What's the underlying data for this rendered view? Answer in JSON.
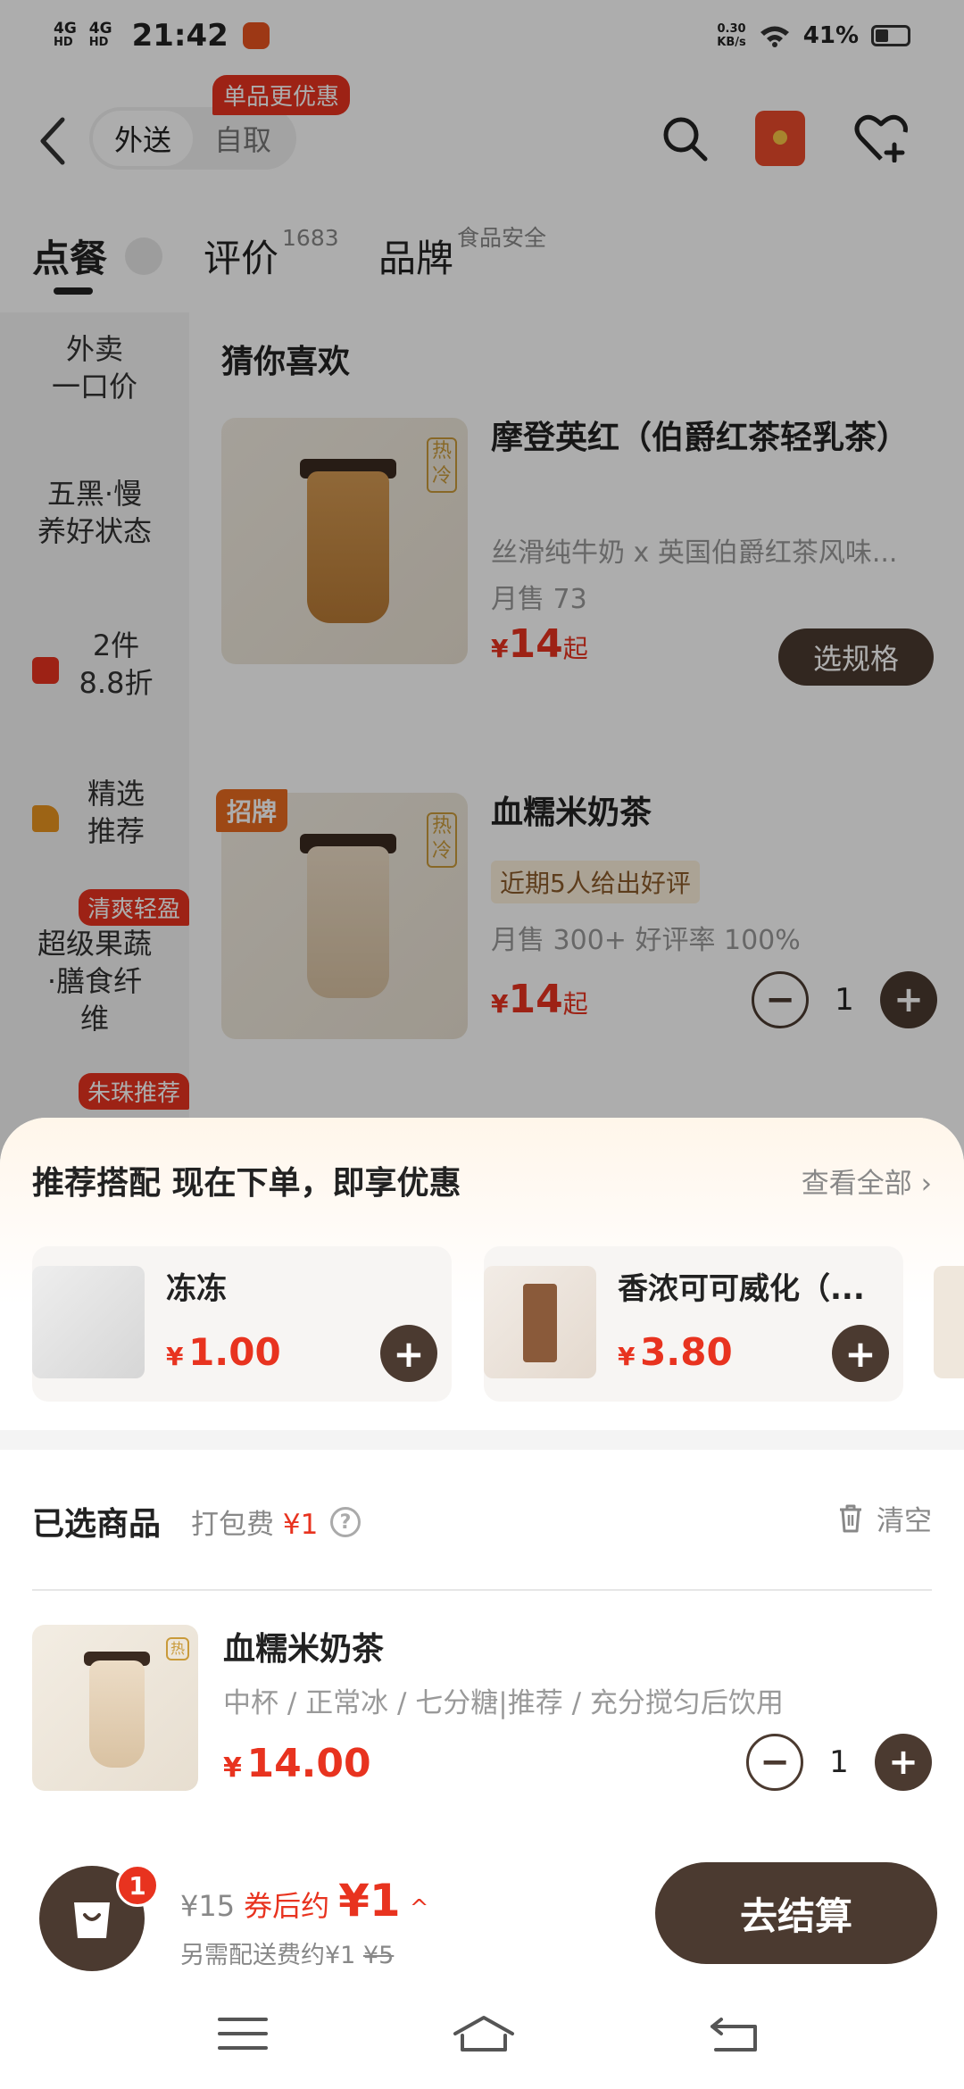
{
  "status_bar": {
    "net1": "4G",
    "net1_sub": "HD",
    "net2": "4G",
    "net2_sub": "HD",
    "time": "21:42",
    "speed_value": "0.30",
    "speed_unit": "KB/s",
    "battery": "41%"
  },
  "nav": {
    "promo_tag": "单品更优惠",
    "mode_delivery": "外送",
    "mode_pickup": "自取"
  },
  "tabs": {
    "order": "点餐",
    "review": "评价",
    "review_count": "1683",
    "brand": "品牌",
    "brand_sub": "食品安全"
  },
  "side_menu": {
    "items": [
      {
        "label": "外卖\n一口价"
      },
      {
        "label": "五黑·慢\n养好状态"
      },
      {
        "label": "2件\n8.8折"
      },
      {
        "label": "精选\n推荐"
      },
      {
        "label": "超级果蔬\n·膳食纤\n维"
      }
    ],
    "badge_fresh": "清爽轻盈",
    "badge_recommend": "朱珠推荐"
  },
  "section": {
    "title": "猜你喜欢"
  },
  "products": [
    {
      "name": "摩登英红（伯爵红茶轻乳茶）",
      "desc": "丝滑纯牛奶 x 英国伯爵红茶风味...",
      "sales": "月售 73",
      "currency": "¥",
      "price": "14",
      "price_suffix": "起",
      "action": "选规格",
      "tag": "热\n冷"
    },
    {
      "name": "血糯米奶茶",
      "badge": "招牌",
      "highlight": "近期5人给出好评",
      "sales": "月售 300+ 好评率 100%",
      "currency": "¥",
      "price": "14",
      "price_suffix": "起",
      "qty": "1",
      "tag": "热\n冷"
    }
  ],
  "recommend": {
    "title": "推荐搭配  现在下单，即享优惠",
    "more": "查看全部 ›",
    "items": [
      {
        "name": "冻冻",
        "currency": "¥",
        "price": "1.00"
      },
      {
        "name": "香浓可可威化（...",
        "currency": "¥",
        "price": "3.80"
      }
    ]
  },
  "selected": {
    "title": "已选商品",
    "fee_label": "打包费",
    "fee": "¥1",
    "help": "?",
    "clear": "清空",
    "item": {
      "name": "血糯米奶茶",
      "spec": "中杯 / 正常冰 / 七分糖|推荐 / 充分搅匀后饮用",
      "currency": "¥",
      "price": "14.00",
      "qty": "1"
    }
  },
  "cart": {
    "count": "1",
    "original": "¥15",
    "after_label": "券后约",
    "after_price": "¥1",
    "chevron": "^",
    "delivery_label": "另需配送费约¥1",
    "delivery_strike": "¥5",
    "checkout": "去结算"
  },
  "colors": {
    "brand_brown": "#4b3a30",
    "price_red": "#e8331f",
    "overlay": "rgba(0,0,0,0.32)"
  },
  "icons": [
    "back-icon",
    "search-icon",
    "red-packet-icon",
    "favorite-add-icon",
    "scroll-top-icon",
    "trash-icon",
    "help-icon",
    "shopping-bag-icon",
    "menu-icon",
    "home-icon",
    "back-nav-icon"
  ]
}
